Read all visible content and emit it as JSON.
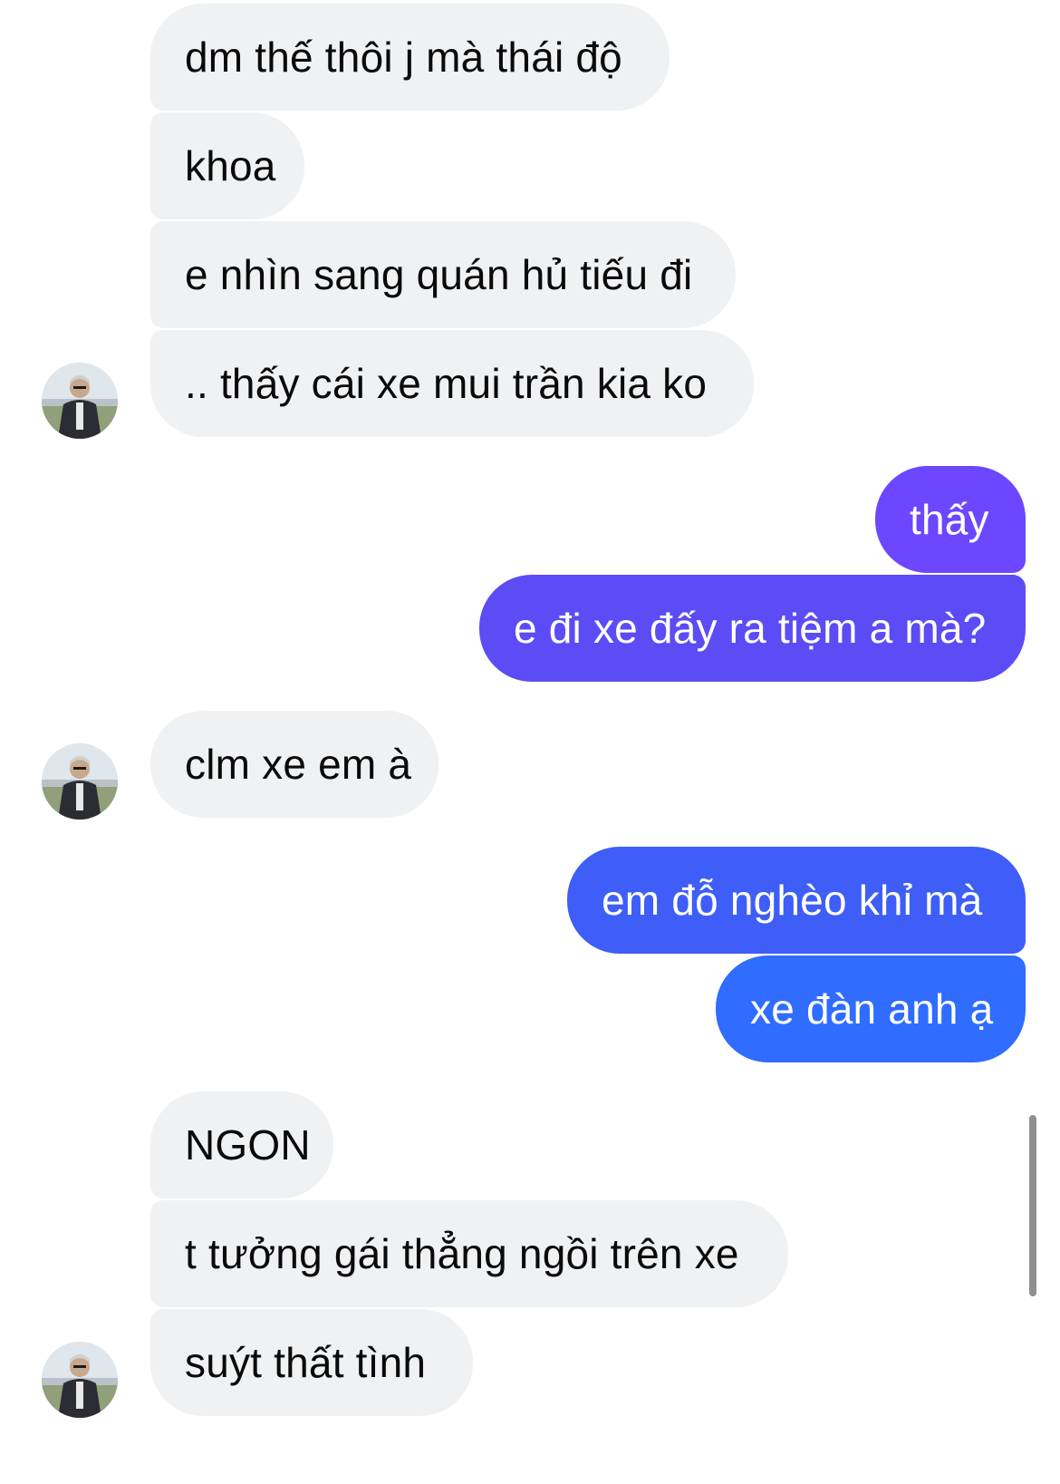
{
  "colors": {
    "incoming_bubble": "#f0f1f3",
    "outgoing_top": "#6c47ff",
    "outgoing_mid": "#5b4cf5",
    "outgoing_bottom": "#2f6cff"
  },
  "avatar_icon": "user-photo-avatar",
  "messages": [
    {
      "direction": "incoming",
      "text": "dm thế thôi j mà thái độ"
    },
    {
      "direction": "incoming",
      "text": "khoa"
    },
    {
      "direction": "incoming",
      "text": "e nhìn sang quán hủ tiếu đi"
    },
    {
      "direction": "incoming",
      "text": ".. thấy cái xe mui trần kia ko"
    },
    {
      "direction": "outgoing",
      "text": "thấy"
    },
    {
      "direction": "outgoing",
      "text": "e đi xe đấy ra tiệm a mà?"
    },
    {
      "direction": "incoming",
      "text": "clm xe em à"
    },
    {
      "direction": "outgoing",
      "text": "em đỗ nghèo khỉ mà"
    },
    {
      "direction": "outgoing",
      "text": "xe đàn anh ạ"
    },
    {
      "direction": "incoming",
      "text": "NGON"
    },
    {
      "direction": "incoming",
      "text": "t tưởng gái thẳng ngồi trên xe"
    },
    {
      "direction": "incoming",
      "text": "suýt thất tình"
    }
  ]
}
